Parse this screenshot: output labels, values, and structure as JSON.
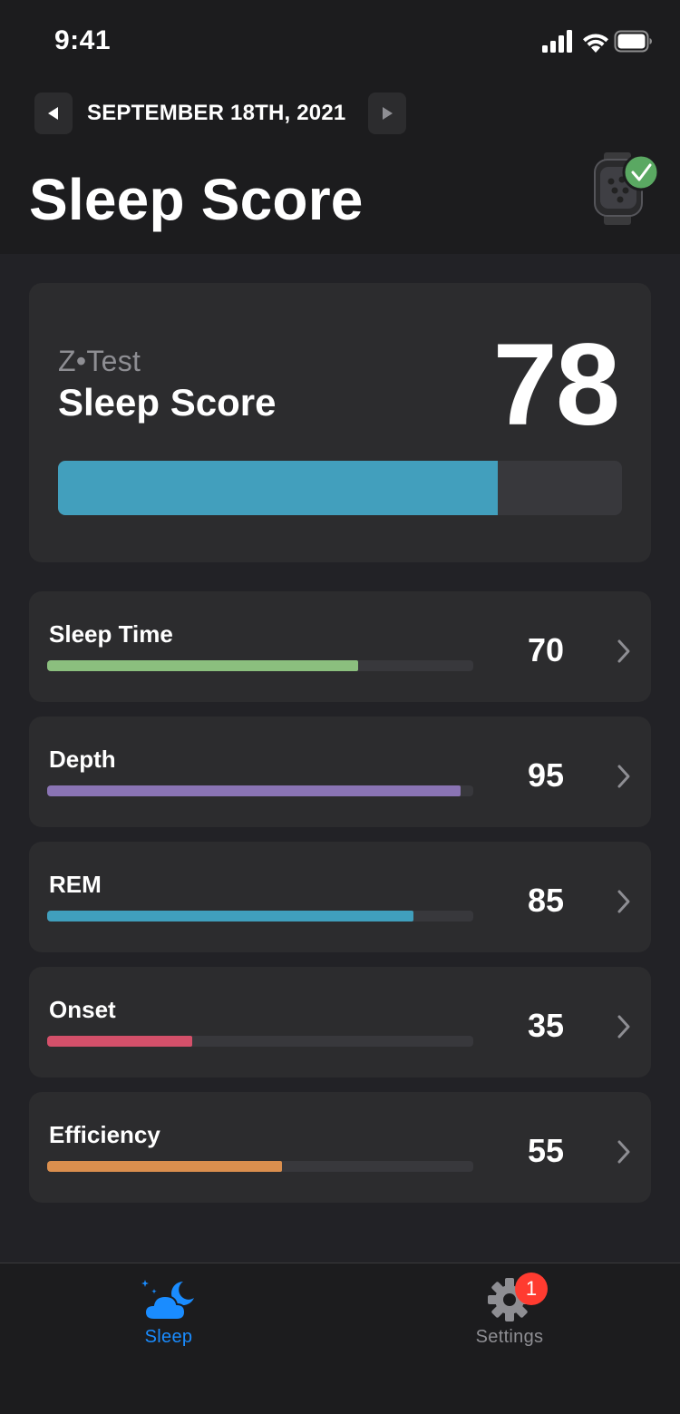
{
  "status_bar": {
    "time": "9:41"
  },
  "header": {
    "date": "SEPTEMBER 18TH, 2021",
    "title": "Sleep Score"
  },
  "score_card": {
    "brand": "Z•Test",
    "label": "Sleep Score",
    "value": "78",
    "progress": 0.78,
    "bar_color": "#429fbd"
  },
  "metrics": [
    {
      "label": "Sleep Time",
      "value": "70",
      "progress": 0.73,
      "color": "#8bbf7e"
    },
    {
      "label": "Depth",
      "value": "95",
      "progress": 0.97,
      "color": "#8a74b4"
    },
    {
      "label": "REM",
      "value": "85",
      "progress": 0.86,
      "color": "#409fbd"
    },
    {
      "label": "Onset",
      "value": "35",
      "progress": 0.34,
      "color": "#d4506a"
    },
    {
      "label": "Efficiency",
      "value": "55",
      "progress": 0.55,
      "color": "#db8f4e"
    }
  ],
  "tabbar": {
    "sleep_label": "Sleep",
    "settings_label": "Settings",
    "settings_badge": "1"
  },
  "colors": {
    "accent": "#1a8cff",
    "check": "#5aa862",
    "badge": "#ff3b30"
  },
  "icons": [
    "signal-icon",
    "wifi-icon",
    "battery-icon",
    "chevron-left-icon",
    "chevron-right-icon",
    "watch-device-icon",
    "check-icon",
    "sleep-cloud-moon-icon",
    "gear-icon"
  ]
}
